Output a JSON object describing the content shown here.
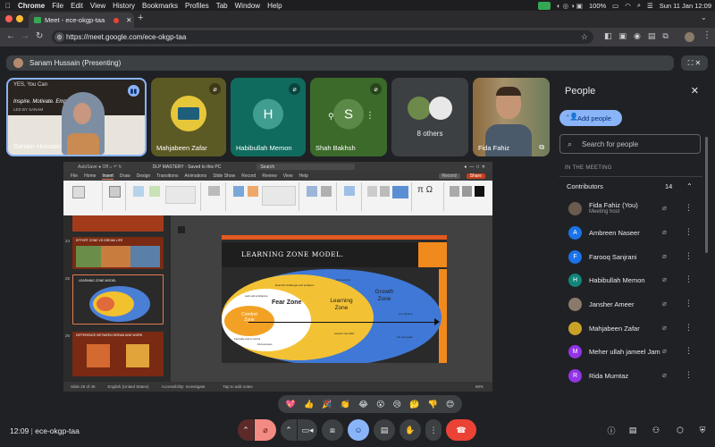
{
  "menubar": {
    "apple": "",
    "items": [
      "Chrome",
      "File",
      "Edit",
      "View",
      "History",
      "Bookmarks",
      "Profiles",
      "Tab",
      "Window",
      "Help"
    ],
    "battery": "100%",
    "datetime": "Sun 11 Jan  12:09"
  },
  "browser": {
    "tab_title": "Meet - ece-okgp-taa",
    "new_tab": "+",
    "url": "https://meet.google.com/ece-okgp-taa"
  },
  "meet": {
    "presenting_label": "Sanam Hussain (Presenting)",
    "tiles": [
      {
        "name": "Sanam Hussain",
        "overlay_line1": "YES, You Can",
        "overlay_line2": "Inspire. Motivate. Empower",
        "overlay_line3": "LED BY SANAM"
      },
      {
        "name": "Mahjabeen Zafar"
      },
      {
        "name": "Habibullah Memon",
        "initial": "H"
      },
      {
        "name": "Shah Bakhsh",
        "initial": "S"
      },
      {
        "name": "8 others"
      },
      {
        "name": "Fida Fahiz"
      }
    ],
    "meeting_code": "12:09 | ece-okgp-taa",
    "time": "12:09",
    "code": "ece-okgp-taa"
  },
  "ppt": {
    "window_title": "DLP MASTERY - Saved to this PC",
    "search": "Search",
    "menu": [
      "File",
      "Home",
      "Insert",
      "Draw",
      "Design",
      "Transitions",
      "Animations",
      "Slide Show",
      "Record",
      "Review",
      "View",
      "Help"
    ],
    "record_btn": "Record",
    "share_btn": "Share",
    "thumb_numbers": [
      "24",
      "25",
      "26"
    ],
    "thumb_titles": [
      "EFFORT ZONE VS DREAM LIFE",
      "LEARNING ZONE MODEL",
      "DIFFERENCE BETWEEN DREAM AND WORK"
    ],
    "slide_title": "LEARNING ZONE MODEL.",
    "zones": {
      "comfort": "Comfort Zone",
      "fear": "Fear Zone",
      "learning": "Learning Zone",
      "growth": "Growth Zone"
    },
    "slide_notes": [
      "Feel safe and in control",
      "Lack self-confidence",
      "Find excuses",
      "Deal with challenges and problems",
      "Acquire new skills",
      "Find purpose",
      "Live dreams",
      "Set new goals"
    ],
    "status": [
      "Slide 25 of 46",
      "English (United States)",
      "Accessibility: Investigate",
      "Tap to add notes",
      "60%"
    ]
  },
  "people_panel": {
    "title": "People",
    "add_people": "Add people",
    "search_placeholder": "Search for people",
    "in_the_meeting": "IN THE MEETING",
    "contributors_label": "Contributors",
    "contributors_count": "14",
    "participants": [
      {
        "name": "Fida Fahiz (You)",
        "sub": "Meeting host",
        "initial": "",
        "color": "#6b5b4e"
      },
      {
        "name": "Ambreen Naseer",
        "initial": "A",
        "color": "#1a73e8"
      },
      {
        "name": "Farooq Sanjrani",
        "initial": "F",
        "color": "#1a73e8"
      },
      {
        "name": "Habibullah Memon",
        "initial": "H",
        "color": "#12857a"
      },
      {
        "name": "Jansher Ameer",
        "initial": "",
        "color": "#8a7a6a"
      },
      {
        "name": "Mahjabeen Zafar",
        "initial": "",
        "color": "#c9a227"
      },
      {
        "name": "Meher ullah jameel Jam...",
        "initial": "M",
        "color": "#9334e6"
      },
      {
        "name": "Rida Mumtaz",
        "initial": "R",
        "color": "#9334e6"
      }
    ]
  },
  "reactions": [
    "💖",
    "👍",
    "🎉",
    "👏",
    "😂",
    "😮",
    "😢",
    "🤔",
    "👎",
    "😊"
  ],
  "colors": {
    "bg": "#202124",
    "accent_blue": "#8ab4f8",
    "end_call": "#ea4335"
  }
}
